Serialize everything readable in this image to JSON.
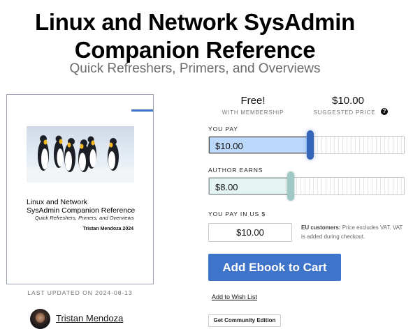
{
  "book": {
    "title_line1": "Linux and Network SysAdmin",
    "title_line2": "Companion Reference",
    "subtitle": "Quick Refreshers, Primers, and Overviews"
  },
  "cover": {
    "title_line1": "Linux and Network",
    "title_line2": "SysAdmin Companion Reference",
    "subtitle": "Quick Refreshers, Primers, and Overviews",
    "author_year": "Tristan Mendoza 2024"
  },
  "meta": {
    "last_updated": "LAST UPDATED ON 2024-08-13",
    "author_name": "Tristan Mendoza"
  },
  "pricing": {
    "free_price": "Free!",
    "free_label": "WITH MEMBERSHIP",
    "suggested_price": "$10.00",
    "suggested_label": "SUGGESTED PRICE",
    "help_glyph": "?",
    "you_pay_label": "YOU PAY",
    "you_pay_value": "$10.00",
    "you_pay_level": 0.52,
    "author_earns_label": "AUTHOR EARNS",
    "author_earns_value": "$8.00",
    "author_earns_level": 0.42,
    "usd_label": "YOU PAY IN US $",
    "usd_value": "$10.00",
    "eu_note_bold": "EU customers:",
    "eu_note_rest": " Price excludes VAT. VAT is added during checkout."
  },
  "actions": {
    "add_to_cart": "Add Ebook to Cart",
    "wish_list": "Add to Wish List",
    "community_edition": "Get Community Edition"
  },
  "colors": {
    "accent": "#3e74c9",
    "pay_fill": "#bcd9fb",
    "earn_fill": "#e4f4f2",
    "pay_handle": "#3565b8",
    "earn_handle": "#9ec9c6"
  },
  "icons": {
    "help": "help-circle-icon",
    "avatar": "author-avatar"
  }
}
